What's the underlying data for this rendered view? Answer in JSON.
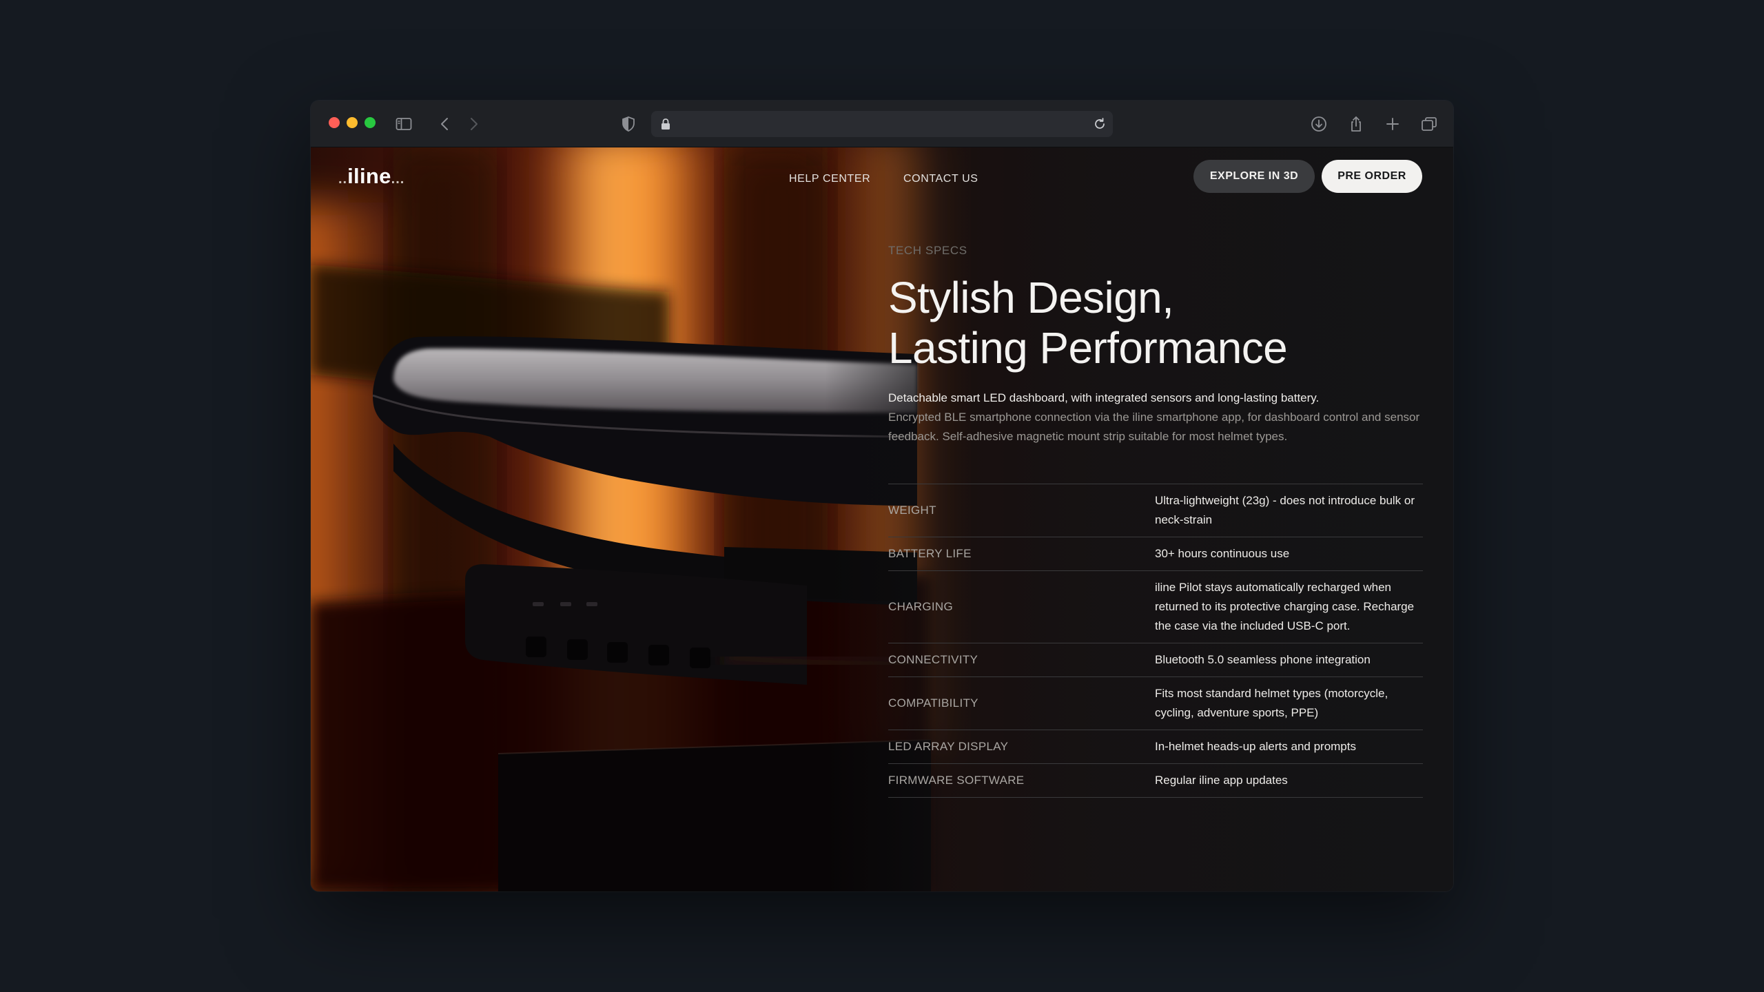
{
  "browser": {
    "url": ""
  },
  "nav": {
    "logo_dots_left": "..",
    "logo_text": "iline",
    "logo_dots_right": "...",
    "links": [
      "HELP CENTER",
      "CONTACT US"
    ],
    "explore_label": "EXPLORE IN 3D",
    "preorder_label": "PRE ORDER"
  },
  "hero": {
    "eyebrow": "TECH SPECS",
    "headline_line1": "Stylish Design,",
    "headline_line2": "Lasting Performance",
    "description_lead": "Detachable smart LED dashboard, with integrated sensors and long-lasting battery.",
    "description_rest": "Encrypted BLE smartphone connection via the iline smartphone app, for dashboard control and sensor feedback. Self-adhesive magnetic mount strip suitable for most helmet types."
  },
  "specs": [
    {
      "label": "WEIGHT",
      "value": "Ultra-lightweight (23g) - does not introduce bulk or neck-strain"
    },
    {
      "label": "BATTERY LIFE",
      "value": "30+ hours continuous use"
    },
    {
      "label": "CHARGING",
      "value": "iline Pilot stays automatically recharged when returned to its protective charging case. Recharge the case via the included USB-C port."
    },
    {
      "label": "CONNECTIVITY",
      "value": "Bluetooth 5.0 seamless phone integration"
    },
    {
      "label": "COMPATIBILITY",
      "value": "Fits most standard helmet types (motorcycle, cycling, adventure sports, PPE)"
    },
    {
      "label": "LED ARRAY DISPLAY",
      "value": "In-helmet heads-up alerts and prompts"
    },
    {
      "label": "FIRMWARE SOFTWARE",
      "value": "Regular iline app updates"
    }
  ],
  "colors": {
    "page_bg": "#151a21",
    "accent_light": "#f2f1ef",
    "glow_orange": "#ff7a1a"
  }
}
